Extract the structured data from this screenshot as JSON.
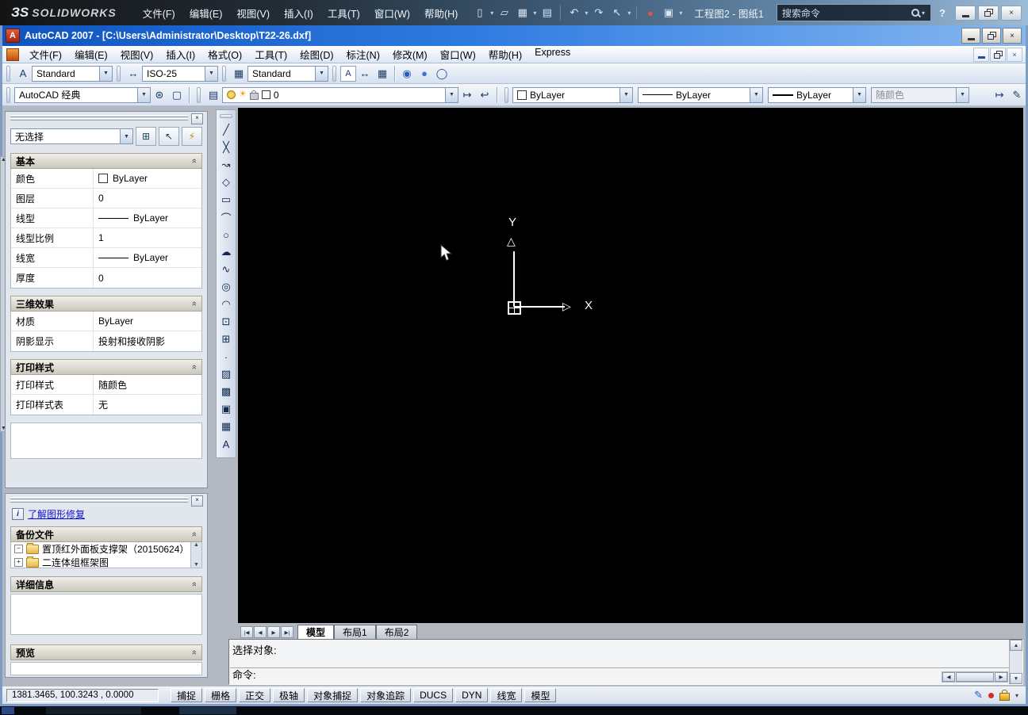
{
  "solidworks": {
    "logo_mark": "ЗS",
    "logo_text": "SOLIDWORKS",
    "menus": [
      "文件(F)",
      "编辑(E)",
      "视图(V)",
      "插入(I)",
      "工具(T)",
      "窗口(W)",
      "帮助(H)"
    ],
    "toolbar_icons": [
      {
        "name": "new-document-icon",
        "glyph": "▯"
      },
      {
        "name": "open-icon",
        "glyph": "▱"
      },
      {
        "name": "save-icon",
        "glyph": "▦"
      },
      {
        "name": "print-icon",
        "glyph": "▤"
      },
      {
        "name": "undo-icon",
        "glyph": "↶"
      },
      {
        "name": "redo-icon",
        "glyph": "↷"
      },
      {
        "name": "select-cursor-icon",
        "glyph": "↖"
      },
      {
        "name": "record-icon",
        "glyph": "●"
      },
      {
        "name": "component-icon",
        "glyph": "▣"
      }
    ],
    "doc_title": "工程图2 - 图纸1",
    "search_placeholder": "搜索命令",
    "help_label": "?"
  },
  "autocad": {
    "title": "AutoCAD 2007 - [C:\\Users\\Administrator\\Desktop\\T22-26.dxf]",
    "menus": [
      "文件(F)",
      "编辑(E)",
      "视图(V)",
      "插入(I)",
      "格式(O)",
      "工具(T)",
      "绘图(D)",
      "标注(N)",
      "修改(M)",
      "窗口(W)",
      "帮助(H)",
      "Express"
    ],
    "styles_toolbar": {
      "text_style": "Standard",
      "dim_style": "ISO-25",
      "table_style": "Standard",
      "icons": [
        {
          "name": "text-style-icon",
          "glyph": "A"
        },
        {
          "name": "dimension-style-icon",
          "glyph": "↔"
        },
        {
          "name": "table-style-icon",
          "glyph": "▦"
        },
        {
          "name": "render-icon",
          "glyph": "◉"
        },
        {
          "name": "sphere-icon",
          "glyph": "●"
        },
        {
          "name": "globe-icon",
          "glyph": "◯"
        }
      ]
    },
    "workspace_toolbar": {
      "workspace": "AutoCAD 经典"
    },
    "layers_toolbar": {
      "layer_name": "0"
    },
    "object_properties": {
      "color": "ByLayer",
      "linetype": "ByLayer",
      "lineweight": "ByLayer",
      "plot_style": "随颜色"
    }
  },
  "draw_toolbar": {
    "tools": [
      {
        "name": "line-tool",
        "label": "直线",
        "glyph": "╱"
      },
      {
        "name": "construction-line-tool",
        "label": "构造线",
        "glyph": "╳"
      },
      {
        "name": "polyline-tool",
        "label": "多段线",
        "glyph": "↝"
      },
      {
        "name": "polygon-tool",
        "label": "正多边形",
        "glyph": "◇"
      },
      {
        "name": "rectangle-tool",
        "label": "矩形",
        "glyph": "▭"
      },
      {
        "name": "arc-tool",
        "label": "圆弧",
        "glyph": "⌒"
      },
      {
        "name": "circle-tool",
        "label": "圆",
        "glyph": "○"
      },
      {
        "name": "revision-cloud-tool",
        "label": "修订云线",
        "glyph": "☁"
      },
      {
        "name": "spline-tool",
        "label": "样条曲线",
        "glyph": "∿"
      },
      {
        "name": "ellipse-tool",
        "label": "椭圆",
        "glyph": "◎"
      },
      {
        "name": "ellipse-arc-tool",
        "label": "椭圆弧",
        "glyph": "◠"
      },
      {
        "name": "insert-block-tool",
        "label": "插入块",
        "glyph": "⊡"
      },
      {
        "name": "make-block-tool",
        "label": "创建块",
        "glyph": "⊞"
      },
      {
        "name": "point-tool",
        "label": "点",
        "glyph": "∙"
      },
      {
        "name": "hatch-tool",
        "label": "图案填充",
        "glyph": "▨"
      },
      {
        "name": "gradient-tool",
        "label": "渐变色",
        "glyph": "▩"
      },
      {
        "name": "region-tool",
        "label": "面域",
        "glyph": "▣"
      },
      {
        "name": "table-tool",
        "label": "表格",
        "glyph": "▦"
      },
      {
        "name": "mtext-tool",
        "label": "多行文字",
        "glyph": "A"
      }
    ]
  },
  "properties_palette": {
    "selection": "无选择",
    "tool_buttons": [
      {
        "name": "pickadd-toggle-button",
        "glyph": "⊞"
      },
      {
        "name": "select-objects-button",
        "glyph": "↖"
      },
      {
        "name": "quick-select-button",
        "glyph": "⚡"
      }
    ],
    "sections": [
      {
        "title": "基本",
        "rows": [
          {
            "label": "颜色",
            "value": "ByLayer"
          },
          {
            "label": "图层",
            "value": "0"
          },
          {
            "label": "线型",
            "value": "ByLayer"
          },
          {
            "label": "线型比例",
            "value": "1"
          },
          {
            "label": "线宽",
            "value": "ByLayer"
          },
          {
            "label": "厚度",
            "value": "0"
          }
        ]
      },
      {
        "title": "三维效果",
        "rows": [
          {
            "label": "材质",
            "value": "ByLayer"
          },
          {
            "label": "阴影显示",
            "value": "投射和接收阴影"
          }
        ]
      },
      {
        "title": "打印样式",
        "rows": [
          {
            "label": "打印样式",
            "value": "随颜色"
          },
          {
            "label": "打印样式表",
            "value": "无"
          }
        ]
      }
    ]
  },
  "recovery_palette": {
    "info_link": "了解图形修复",
    "backup_title": "备份文件",
    "details_title": "详细信息",
    "preview_title": "预览",
    "backup_items": [
      "置顶红外面板支撑架（20150624）",
      "二连体组框架图"
    ]
  },
  "canvas": {
    "ucs_x_label": "X",
    "ucs_y_label": "Y"
  },
  "layout_tabs": {
    "nav": [
      "|◀",
      "◀",
      "▶",
      "▶|"
    ],
    "tabs": [
      "模型",
      "布局1",
      "布局2"
    ],
    "active": "模型"
  },
  "command": {
    "history_line": "选择对象:",
    "prompt_line": "命令:"
  },
  "status_bar": {
    "coordinates": "1381.3465, 100.3243 , 0.0000",
    "toggles": [
      {
        "name": "snap-toggle",
        "label": "捕捉"
      },
      {
        "name": "grid-toggle",
        "label": "栅格"
      },
      {
        "name": "ortho-toggle",
        "label": "正交"
      },
      {
        "name": "polar-toggle",
        "label": "极轴"
      },
      {
        "name": "osnap-toggle",
        "label": "对象捕捉"
      },
      {
        "name": "otrack-toggle",
        "label": "对象追踪"
      },
      {
        "name": "ducs-toggle",
        "label": "DUCS"
      },
      {
        "name": "dyn-toggle",
        "label": "DYN"
      },
      {
        "name": "lwt-toggle",
        "label": "线宽"
      },
      {
        "name": "model-toggle",
        "label": "模型"
      }
    ]
  }
}
